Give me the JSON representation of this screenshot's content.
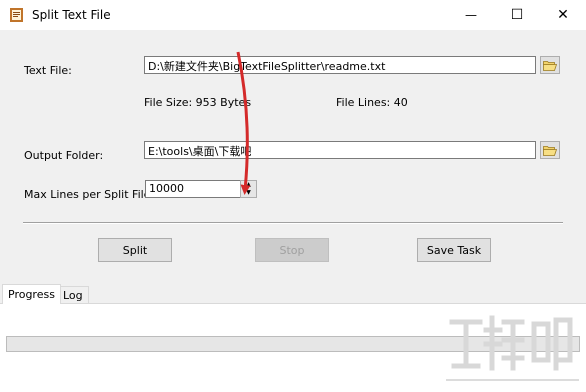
{
  "window": {
    "title": "Split Text File",
    "minimize_glyph": "—",
    "maximize_glyph": "☐",
    "close_glyph": "✕"
  },
  "form": {
    "text_file_label": "Text File:",
    "text_file_value": "D:\\新建文件夹\\BigTextFileSplitter\\readme.txt",
    "file_size_text": "File Size: 953 Bytes",
    "file_lines_text": "File Lines: 40",
    "output_folder_label": "Output Folder:",
    "output_folder_value": "E:\\tools\\桌面\\下载吧",
    "max_lines_label": "Max Lines per Split File",
    "max_lines_value": "10000"
  },
  "buttons": {
    "split": "Split",
    "stop": "Stop",
    "save_task": "Save Task"
  },
  "tabs": {
    "progress": "Progress",
    "log": "Log"
  },
  "progress": {
    "fraction": 0
  },
  "icons": {
    "app": "text-file-icon",
    "browse": "folder-open-icon"
  },
  "colors": {
    "annotation_arrow": "#d42a2a",
    "progress_fill": "#06b025"
  }
}
